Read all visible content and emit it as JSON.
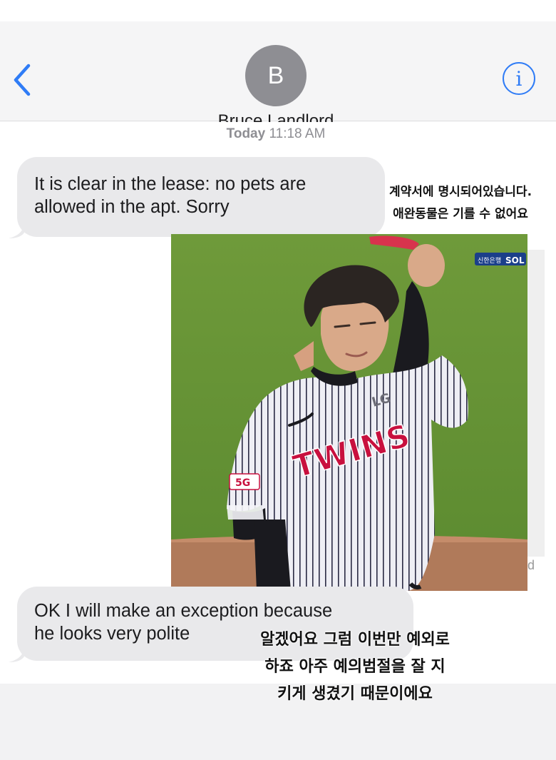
{
  "header": {
    "avatar_initial": "B",
    "contact_name": "Bruce Landlord",
    "back_icon": "chevron-left-icon",
    "info_icon": "info-icon",
    "info_glyph": "i"
  },
  "conversation": {
    "timestamp_day": "Today",
    "timestamp_time": "11:18 AM",
    "messages": [
      {
        "text": "It is clear in the lease: no pets are\nallowed in the apt. Sorry"
      },
      {
        "text": "OK I will make an exception because\nhe looks very polite"
      }
    ]
  },
  "overlays": {
    "caption_1": "계약서에 명시되어있습니다.\n애완동물은 기를 수 없어요",
    "caption_2": "알겠어요 그럼 이번만 예외로\n하죠 아주 예의범절을 잘 지\n키게 생겼기 때문이에요"
  },
  "photo": {
    "jersey_text": "TWINS",
    "jersey_logo": "LG",
    "sleeve_patch": "5G",
    "broadcast_logo_korean": "신한은행",
    "broadcast_logo_latin": "SOL"
  },
  "colors": {
    "ios_blue": "#2f7cf6",
    "bubble_gray": "#e9e9eb",
    "avatar_gray": "#8e8e93",
    "twins_red": "#c8103e"
  }
}
